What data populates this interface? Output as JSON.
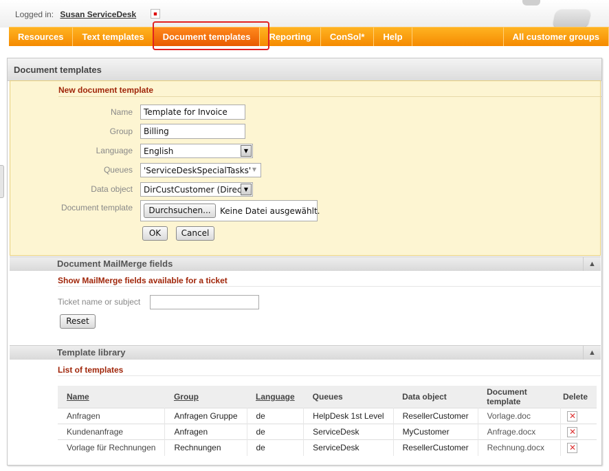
{
  "header": {
    "logged_in_label": "Logged in:",
    "user_name": "Susan ServiceDesk"
  },
  "nav": {
    "items": [
      "Resources",
      "Text templates",
      "Document templates",
      "Reporting",
      "ConSol*",
      "Help"
    ],
    "right": "All customer groups",
    "active": "Document templates"
  },
  "panel_title": "Document templates",
  "new_template": {
    "title": "New document template",
    "name_label": "Name",
    "name_value": "Template for Invoice",
    "group_label": "Group",
    "group_value": "Billing",
    "language_label": "Language",
    "language_value": "English",
    "queues_label": "Queues",
    "queues_value": "'ServiceDeskSpecialTasks'",
    "data_object_label": "Data object",
    "data_object_value": "DirCustCustomer (DirectC",
    "document_template_label": "Document template",
    "browse_label": "Durchsuchen...",
    "no_file_label": "Keine Datei ausgewählt.",
    "ok_label": "OK",
    "cancel_label": "Cancel"
  },
  "mailmerge": {
    "title": "Document MailMerge fields",
    "subtitle": "Show MailMerge fields available for a ticket",
    "ticket_label": "Ticket name or subject",
    "ticket_value": "",
    "reset_label": "Reset"
  },
  "library": {
    "title": "Template library",
    "subtitle": "List of templates",
    "columns": [
      "Name",
      "Group",
      "Language",
      "Queues",
      "Data object",
      "Document template",
      "Delete"
    ],
    "rows": [
      [
        "Anfragen",
        "Anfragen Gruppe",
        "de",
        "HelpDesk 1st Level",
        "ResellerCustomer",
        "Vorlage.doc"
      ],
      [
        "Kundenanfrage",
        "Anfragen",
        "de",
        "ServiceDesk",
        "MyCustomer",
        "Anfrage.docx"
      ],
      [
        "Vorlage für Rechnungen",
        "Rechnungen",
        "de",
        "ServiceDesk",
        "ResellerCustomer",
        "Rechnung.docx"
      ]
    ]
  },
  "colors": {
    "nav_orange": "#f58a00",
    "accent_red": "#a0260a",
    "form_bg": "#fdf5d2"
  }
}
